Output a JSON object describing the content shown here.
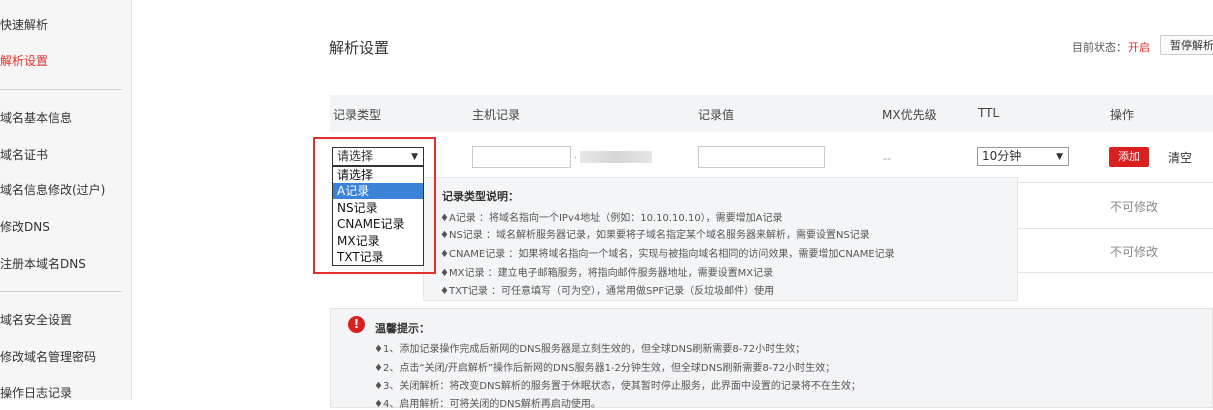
{
  "sidebar": {
    "items": [
      {
        "label": "快速解析",
        "active": false
      },
      {
        "label": "解析设置",
        "active": true
      },
      {
        "label": "域名基本信息",
        "active": false
      },
      {
        "label": "域名证书",
        "active": false
      },
      {
        "label": "域名信息修改(过户)",
        "active": false
      },
      {
        "label": "修改DNS",
        "active": false
      },
      {
        "label": "注册本域名DNS",
        "active": false
      },
      {
        "label": "域名安全设置",
        "active": false
      },
      {
        "label": "修改域名管理密码",
        "active": false
      },
      {
        "label": "操作日志记录",
        "active": false
      }
    ]
  },
  "header": {
    "title": "解析设置",
    "status_label": "目前状态：",
    "status_value": "开启",
    "pause_button": "暂停解析"
  },
  "table": {
    "columns": [
      "记录类型",
      "主机记录",
      "记录值",
      "MX优先级",
      "TTL",
      "操作"
    ],
    "new_row": {
      "record_type": "请选择",
      "host_value": "",
      "record_value": "",
      "mx_priority": "--",
      "ttl": "10分钟",
      "add_button": "添加",
      "clear_link": "清空"
    },
    "existing_rows": [
      {
        "action": "不可修改"
      },
      {
        "action": "不可修改"
      }
    ]
  },
  "record_type_options": [
    "请选择",
    "A记录",
    "NS记录",
    "CNAME记录",
    "MX记录",
    "TXT记录"
  ],
  "record_type_selected_index": 1,
  "help": {
    "title": "记录类型说明：",
    "lines": [
      "♦A记录 ：将域名指向一个IPv4地址（例如：10.10.10.10），需要增加A记录",
      "♦NS记录 ：域名解析服务器记录，如果要将子域名指定某个域名服务器来解析，需要设置NS记录",
      "♦CNAME记录 ：如果将域名指向一个域名，实现与被指向域名相同的访问效果，需要增加CNAME记录",
      "♦MX记录 ：建立电子邮箱服务，将指向邮件服务器地址，需要设置MX记录",
      "♦TXT记录 ：可任意填写（可为空），通常用做SPF记录（反垃圾邮件）使用"
    ]
  },
  "tips": {
    "icon": "!",
    "title": "温馨提示：",
    "lines": [
      "♦1、添加记录操作完成后新网的DNS服务器是立刻生效的，但全球DNS刷新需要8-72小时生效；",
      "♦2、点击“关闭/开启解析”操作后新网的DNS服务器1-2分钟生效，但全球DNS刷新需要8-72小时生效；",
      "♦3、关闭解析：将改变DNS解析的服务置于休眠状态，使其暂时停止服务，此界面中设置的记录将不在生效；",
      "♦4、启用解析：可将关闭的DNS解析再启动使用。"
    ]
  },
  "colors": {
    "accent_red": "#d9201f",
    "selected_blue": "#3b83d8"
  }
}
